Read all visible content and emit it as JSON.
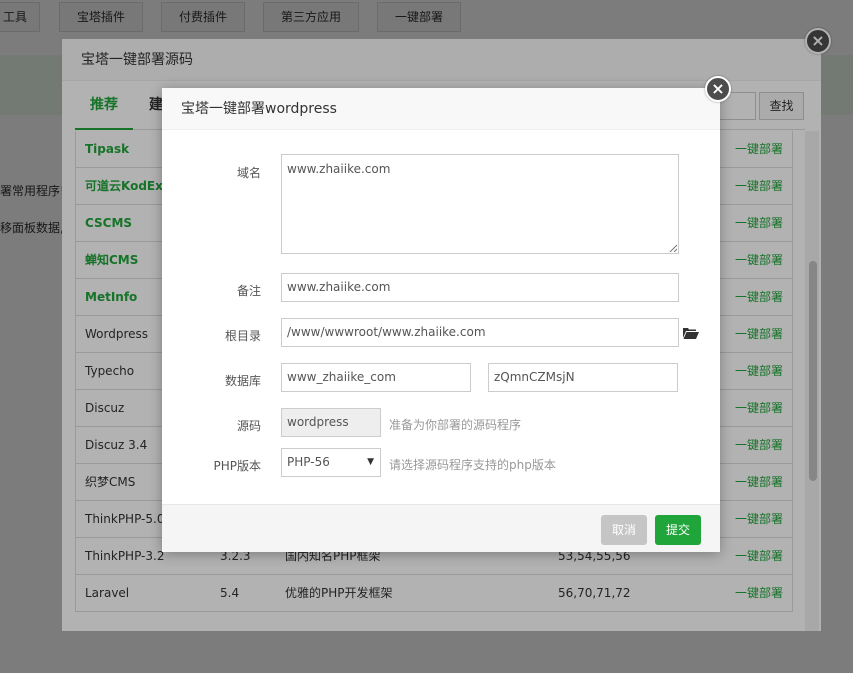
{
  "top_tabs": [
    "工具",
    "宝塔插件",
    "付费插件",
    "第三方应用",
    "一键部署"
  ],
  "bg_texts": [
    "署常用程序!",
    "移面板数据,"
  ],
  "outer": {
    "title": "宝塔一键部署源码",
    "tabs": [
      "推荐",
      "建"
    ],
    "search_label": "查找",
    "close_icon": "×",
    "rows": [
      {
        "name": "Tipask",
        "version": "",
        "desc": "",
        "php": "",
        "op": "一键部署",
        "highlight": true
      },
      {
        "name": "可道云KodExplorer",
        "version": "",
        "desc": "",
        "php": "",
        "op": "一键部署",
        "highlight": true
      },
      {
        "name": "CSCMS",
        "version": "",
        "desc": "",
        "php": "",
        "op": "一键部署",
        "highlight": true
      },
      {
        "name": "蝉知CMS",
        "version": "",
        "desc": "",
        "php": "",
        "op": "一键部署",
        "highlight": true
      },
      {
        "name": "MetInfo",
        "version": "",
        "desc": "",
        "php": "",
        "op": "一键部署",
        "highlight": true
      },
      {
        "name": "Wordpress",
        "version": "",
        "desc": "",
        "php": "",
        "op": "一键部署",
        "highlight": false
      },
      {
        "name": "Typecho",
        "version": "",
        "desc": "",
        "php": "",
        "op": "一键部署",
        "highlight": false
      },
      {
        "name": "Discuz",
        "version": "",
        "desc": "",
        "php": "",
        "op": "一键部署",
        "highlight": false
      },
      {
        "name": "Discuz 3.4",
        "version": "",
        "desc": "",
        "php": "",
        "op": "一键部署",
        "highlight": false
      },
      {
        "name": "织梦CMS",
        "version": "",
        "desc": "",
        "php": "",
        "op": "一键部署",
        "highlight": false
      },
      {
        "name": "ThinkPHP-5.0",
        "version": "",
        "desc": "",
        "php": "",
        "op": "一键部署",
        "highlight": false
      },
      {
        "name": "ThinkPHP-3.2",
        "version": "3.2.3",
        "desc": "国内知名PHP框架",
        "php": "53,54,55,56",
        "op": "一键部署",
        "highlight": false
      },
      {
        "name": "Laravel",
        "version": "5.4",
        "desc": "优雅的PHP开发框架",
        "php": "56,70,71,72",
        "op": "一键部署",
        "highlight": false
      }
    ]
  },
  "inner": {
    "title": "宝塔一键部署wordpress",
    "close_icon": "×",
    "domain_label": "域名",
    "domain_value": "www.zhaiike.com",
    "remark_label": "备注",
    "remark_value": "www.zhaiike.com",
    "root_label": "根目录",
    "root_value": "/www/wwwroot/www.zhaiike.com",
    "folder_icon": "folder-open-icon",
    "db_label": "数据库",
    "db_name": "www_zhaiike_com",
    "db_password": "zQmnCZMsjN",
    "source_label": "源码",
    "source_value": "wordpress",
    "source_hint": "准备为你部署的源码程序",
    "php_label": "PHP版本",
    "php_value": "PHP-56",
    "php_hint": "请选择源码程序支持的php版本",
    "cancel_label": "取消",
    "submit_label": "提交"
  },
  "colors": {
    "accent": "#20a53a",
    "overlay": "rgba(0,0,0,0.3)"
  }
}
